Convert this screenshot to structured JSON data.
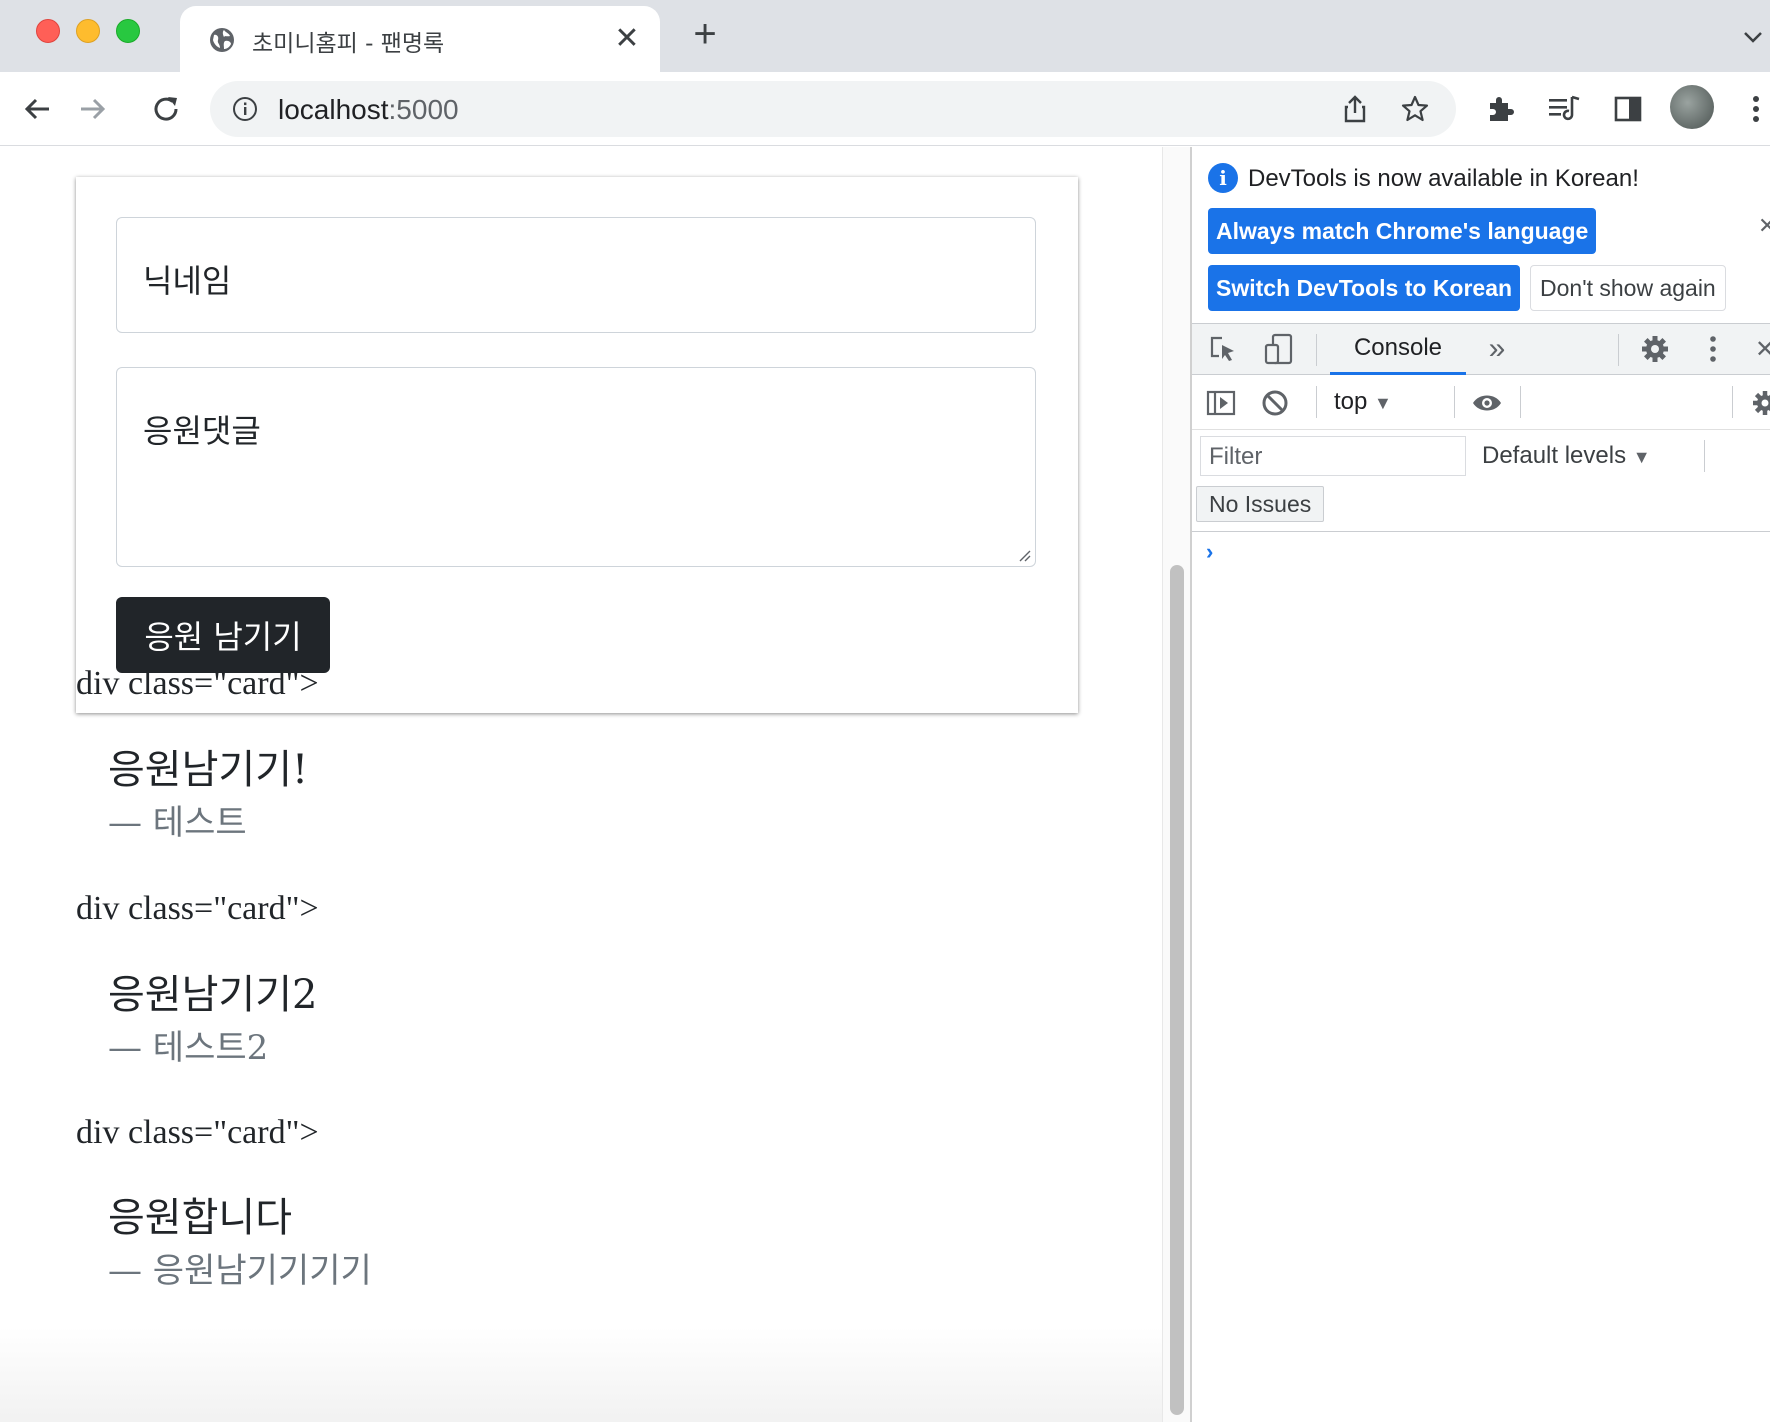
{
  "browser": {
    "tab_title": "초미니홈피 - 팬명록",
    "tab_close": "✕",
    "new_tab": "+",
    "url_host": "localhost",
    "url_port": ":5000"
  },
  "form": {
    "nickname_placeholder": "닉네임",
    "comment_placeholder": "응원댓글",
    "submit_label": "응원 남기기"
  },
  "cards": [
    {
      "stray_text": "div class=\"card\">",
      "comment": "응원남기기!",
      "author": "— 테스트"
    },
    {
      "stray_text": "div class=\"card\">",
      "comment": "응원남기기2",
      "author": "— 테스트2"
    },
    {
      "stray_text": "div class=\"card\">",
      "comment": "응원합니다",
      "author": "— 응원남기기기기"
    }
  ],
  "devtools": {
    "banner_text": "DevTools is now available in Korean!",
    "always_match_label": "Always match Chrome's language",
    "switch_label": "Switch DevTools to Korean",
    "dont_show_label": "Don't show again",
    "console_tab": "Console",
    "more_tabs": "»",
    "context_label": "top",
    "filter_placeholder": "Filter",
    "levels_label": "Default levels",
    "issues_label": "No Issues",
    "prompt_glyph": "›"
  },
  "colors": {
    "accent": "#1a73e8",
    "submit_bg": "#212529",
    "muted_text": "#6c757d"
  }
}
